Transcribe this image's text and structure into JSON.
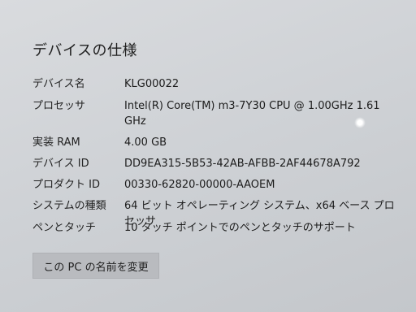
{
  "section_title": "デバイスの仕様",
  "specs": [
    {
      "label": "デバイス名",
      "value": "KLG00022"
    },
    {
      "label": "プロセッサ",
      "value": "Intel(R) Core(TM) m3-7Y30 CPU @ 1.00GHz   1.61 GHz"
    },
    {
      "label": "実装 RAM",
      "value": "4.00 GB"
    },
    {
      "label": "デバイス ID",
      "value": "DD9EA315-5B53-42AB-AFBB-2AF44678A792"
    },
    {
      "label": "プロダクト ID",
      "value": "00330-62820-00000-AAOEM"
    },
    {
      "label": "システムの種類",
      "value": "64 ビット オペレーティング システム、x64 ベース プロセッサ"
    },
    {
      "label": "ペンとタッチ",
      "value": "10 タッチ ポイントでのペンとタッチのサポート"
    }
  ],
  "rename_button_label": "この PC の名前を変更"
}
